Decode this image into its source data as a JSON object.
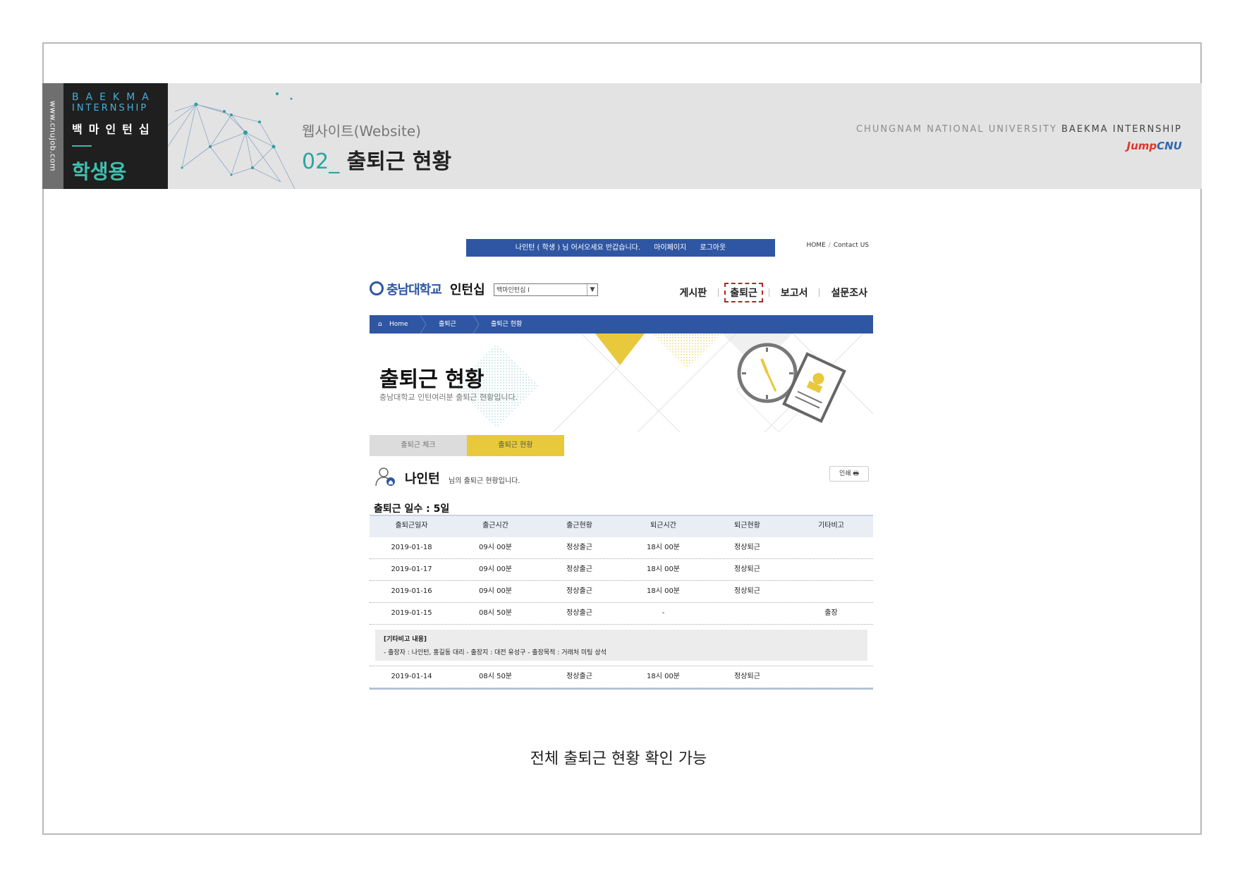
{
  "banner": {
    "side_url": "www.cnujob.com",
    "brand_en1": "BAEKMA",
    "brand_en2": "INTERNSHIP",
    "brand_ko": "백마인턴십",
    "user_type": "학생용",
    "subtitle": "웹사이트(Website)",
    "title_num": "02",
    "title_sep": "_",
    "title": "출퇴근 현황",
    "right_text_prefix": "CHUNGNAM NATIONAL UNIVERSITY",
    "right_text_bold": "BAEKMA INTERNSHIP",
    "jump_a": "Jump",
    "jump_b": "CNU"
  },
  "site": {
    "topbar": {
      "greeting": "나인턴 ( 학생 ) 님 어서오세요 반갑습니다.",
      "mypage": "마이페이지",
      "logout": "로그아웃"
    },
    "toplinks": {
      "home": "HOME",
      "sep": "/",
      "contact": "Contact US"
    },
    "logo": {
      "univ": "충남대학교",
      "suffix": "인턴십"
    },
    "select_value": "백마인턴십 I",
    "nav": [
      "게시판",
      "출퇴근",
      "보고서",
      "설문조사"
    ],
    "breadcrumb": [
      "Home",
      "출퇴근",
      "출퇴근 현황"
    ],
    "hero": {
      "title": "출퇴근 현황",
      "subtitle": "충남대학교 인턴여러분 출퇴근 현황입니다."
    },
    "tabs": [
      "출퇴근 체크",
      "출퇴근 현황"
    ],
    "user": {
      "name": "나인턴",
      "message": "님의 출퇴근 현황입니다.",
      "print": "인쇄"
    },
    "days_label": "출퇴근 일수 : 5일",
    "table": {
      "headers": [
        "출퇴근일자",
        "출근시간",
        "출근현황",
        "퇴근시간",
        "퇴근현황",
        "기타비고"
      ],
      "rows": [
        [
          "2019-01-18",
          "09시 00분",
          "정상출근",
          "18시 00분",
          "정상퇴근",
          ""
        ],
        [
          "2019-01-17",
          "09시 00분",
          "정상출근",
          "18시 00분",
          "정상퇴근",
          ""
        ],
        [
          "2019-01-16",
          "09시 00분",
          "정상출근",
          "18시 00분",
          "정상퇴근",
          ""
        ],
        [
          "2019-01-15",
          "08시 50분",
          "정상출근",
          "-",
          "",
          "출장"
        ]
      ],
      "note_title": "[기타비고 내용]",
      "note_text": "- 출장자 : 나인턴, 홍길동 대리 - 출장지 : 대전 유성구 - 출장목적 : 거래처 미팅 상석",
      "last_row": [
        "2019-01-14",
        "08시 50분",
        "정상출근",
        "18시 00분",
        "정상퇴근",
        ""
      ]
    }
  },
  "caption": "전체 출퇴근 현황 확인 가능",
  "colors": {
    "navy": "#2f56a3",
    "teal": "#3fc0ae",
    "yellow": "#e8c93b",
    "red": "#b22222"
  }
}
